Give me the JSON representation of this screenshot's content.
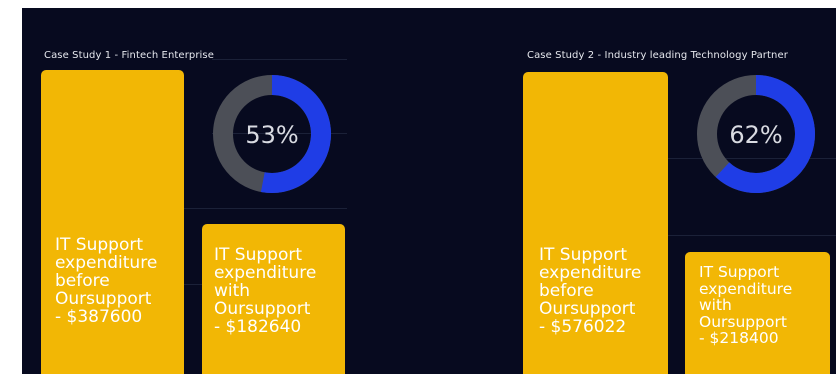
{
  "chart_data": [
    {
      "type": "bar",
      "title": "Case Study 1 - Fintech Enterprise",
      "categories": [
        "IT Support expenditure before Oursupport",
        "IT Support expenditure with Oursupport"
      ],
      "values": [
        387600,
        182640
      ],
      "bar_labels": [
        "IT Support\nexpenditure\nbefore\nOursupport\n- $387600",
        "IT Support\nexpenditure\nwith\nOursupport\n- $182640"
      ],
      "donut": {
        "value": 53,
        "label": "53%"
      }
    },
    {
      "type": "bar",
      "title": "Case Study 2 - Industry leading Technology Partner",
      "categories": [
        "IT Support expenditure before Oursupport",
        "IT Support expenditure with Oursupport"
      ],
      "values": [
        576022,
        218400
      ],
      "bar_labels": [
        "IT Support\nexpenditure\nbefore\nOursupport\n- $576022",
        "IT Support\nexpenditure\nwith\nOursupport\n- $218400"
      ],
      "donut": {
        "value": 62,
        "label": "62%"
      }
    }
  ],
  "colors": {
    "background": "#070a1f",
    "bar": "#f2b705",
    "donut_fill": "#1f3de6",
    "donut_track": "#4c4f57",
    "text": "#ffffff"
  }
}
